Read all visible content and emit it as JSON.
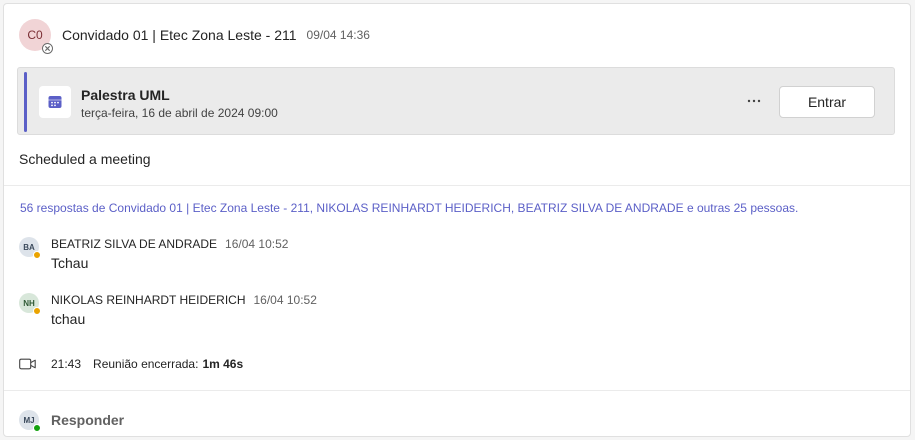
{
  "post": {
    "author_initials": "C0",
    "author": "Convidado 01 | Etec Zona Leste - 211",
    "timestamp": "09/04 14:36",
    "body": "Scheduled a meeting"
  },
  "meeting": {
    "title": "Palestra UML",
    "datetime": "terça-feira, 16 de abril de 2024 09:00",
    "more_label": "···",
    "join_label": "Entrar",
    "icon": "calendar-icon",
    "accent_color": "#5b5fc7"
  },
  "replies_summary": "56 respostas de Convidado 01 | Etec Zona Leste - 211, NIKOLAS REINHARDT HEIDERICH, BEATRIZ SILVA DE ANDRADE e outras 25 pessoas.",
  "replies": [
    {
      "initials": "BA",
      "author": "BEATRIZ SILVA DE ANDRADE",
      "time": "16/04 10:52",
      "message": "Tchau",
      "status": "away"
    },
    {
      "initials": "NH",
      "author": "NIKOLAS REINHARDT HEIDERICH",
      "time": "16/04 10:52",
      "message": "tchau",
      "status": "away"
    }
  ],
  "meeting_ended": {
    "icon": "video-camera-icon",
    "time": "21:43",
    "label": "Reunião encerrada:",
    "duration": "1m 46s"
  },
  "composer": {
    "initials": "MJ",
    "label": "Responder",
    "status": "available"
  }
}
